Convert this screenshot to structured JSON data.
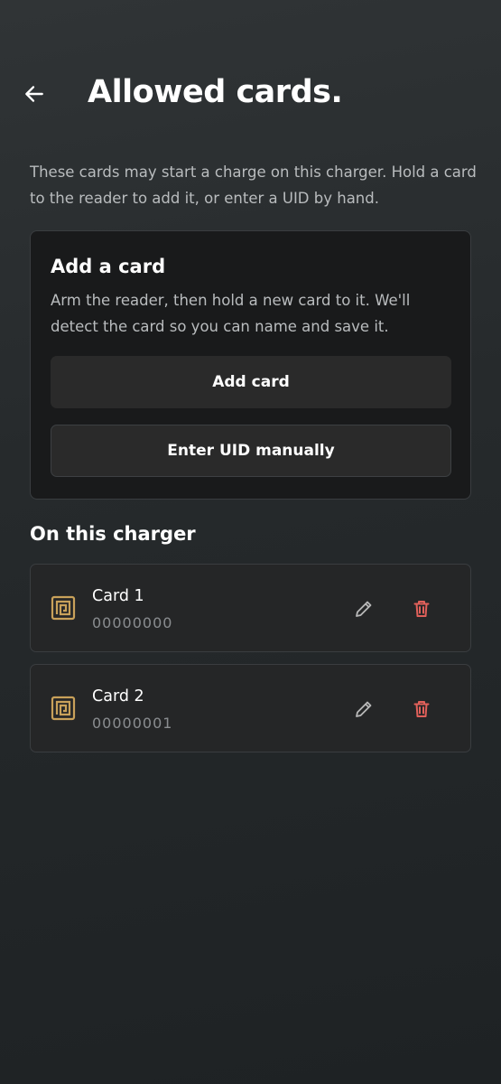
{
  "header": {
    "title": "Allowed cards."
  },
  "intro": "These cards may start a charge on this charger. Hold a card to the reader to add it, or enter a UID by hand.",
  "add_card": {
    "title": "Add a card",
    "description": "Arm the reader, then hold a new card to it. We'll detect the card so you can name and save it.",
    "add_button_label": "Add card",
    "manual_button_label": "Enter UID manually"
  },
  "section": {
    "title": "On this charger"
  },
  "cards": [
    {
      "name": "Card 1",
      "uid": "00000000"
    },
    {
      "name": "Card 2",
      "uid": "00000001"
    }
  ],
  "colors": {
    "accent_gold": "#c9a15a",
    "delete_red": "#e0605a",
    "edit_gray": "#b8b8b8"
  },
  "icons": {
    "back": "arrow-left-icon",
    "card": "nfc-card-icon",
    "edit": "pencil-icon",
    "delete": "trash-icon"
  }
}
